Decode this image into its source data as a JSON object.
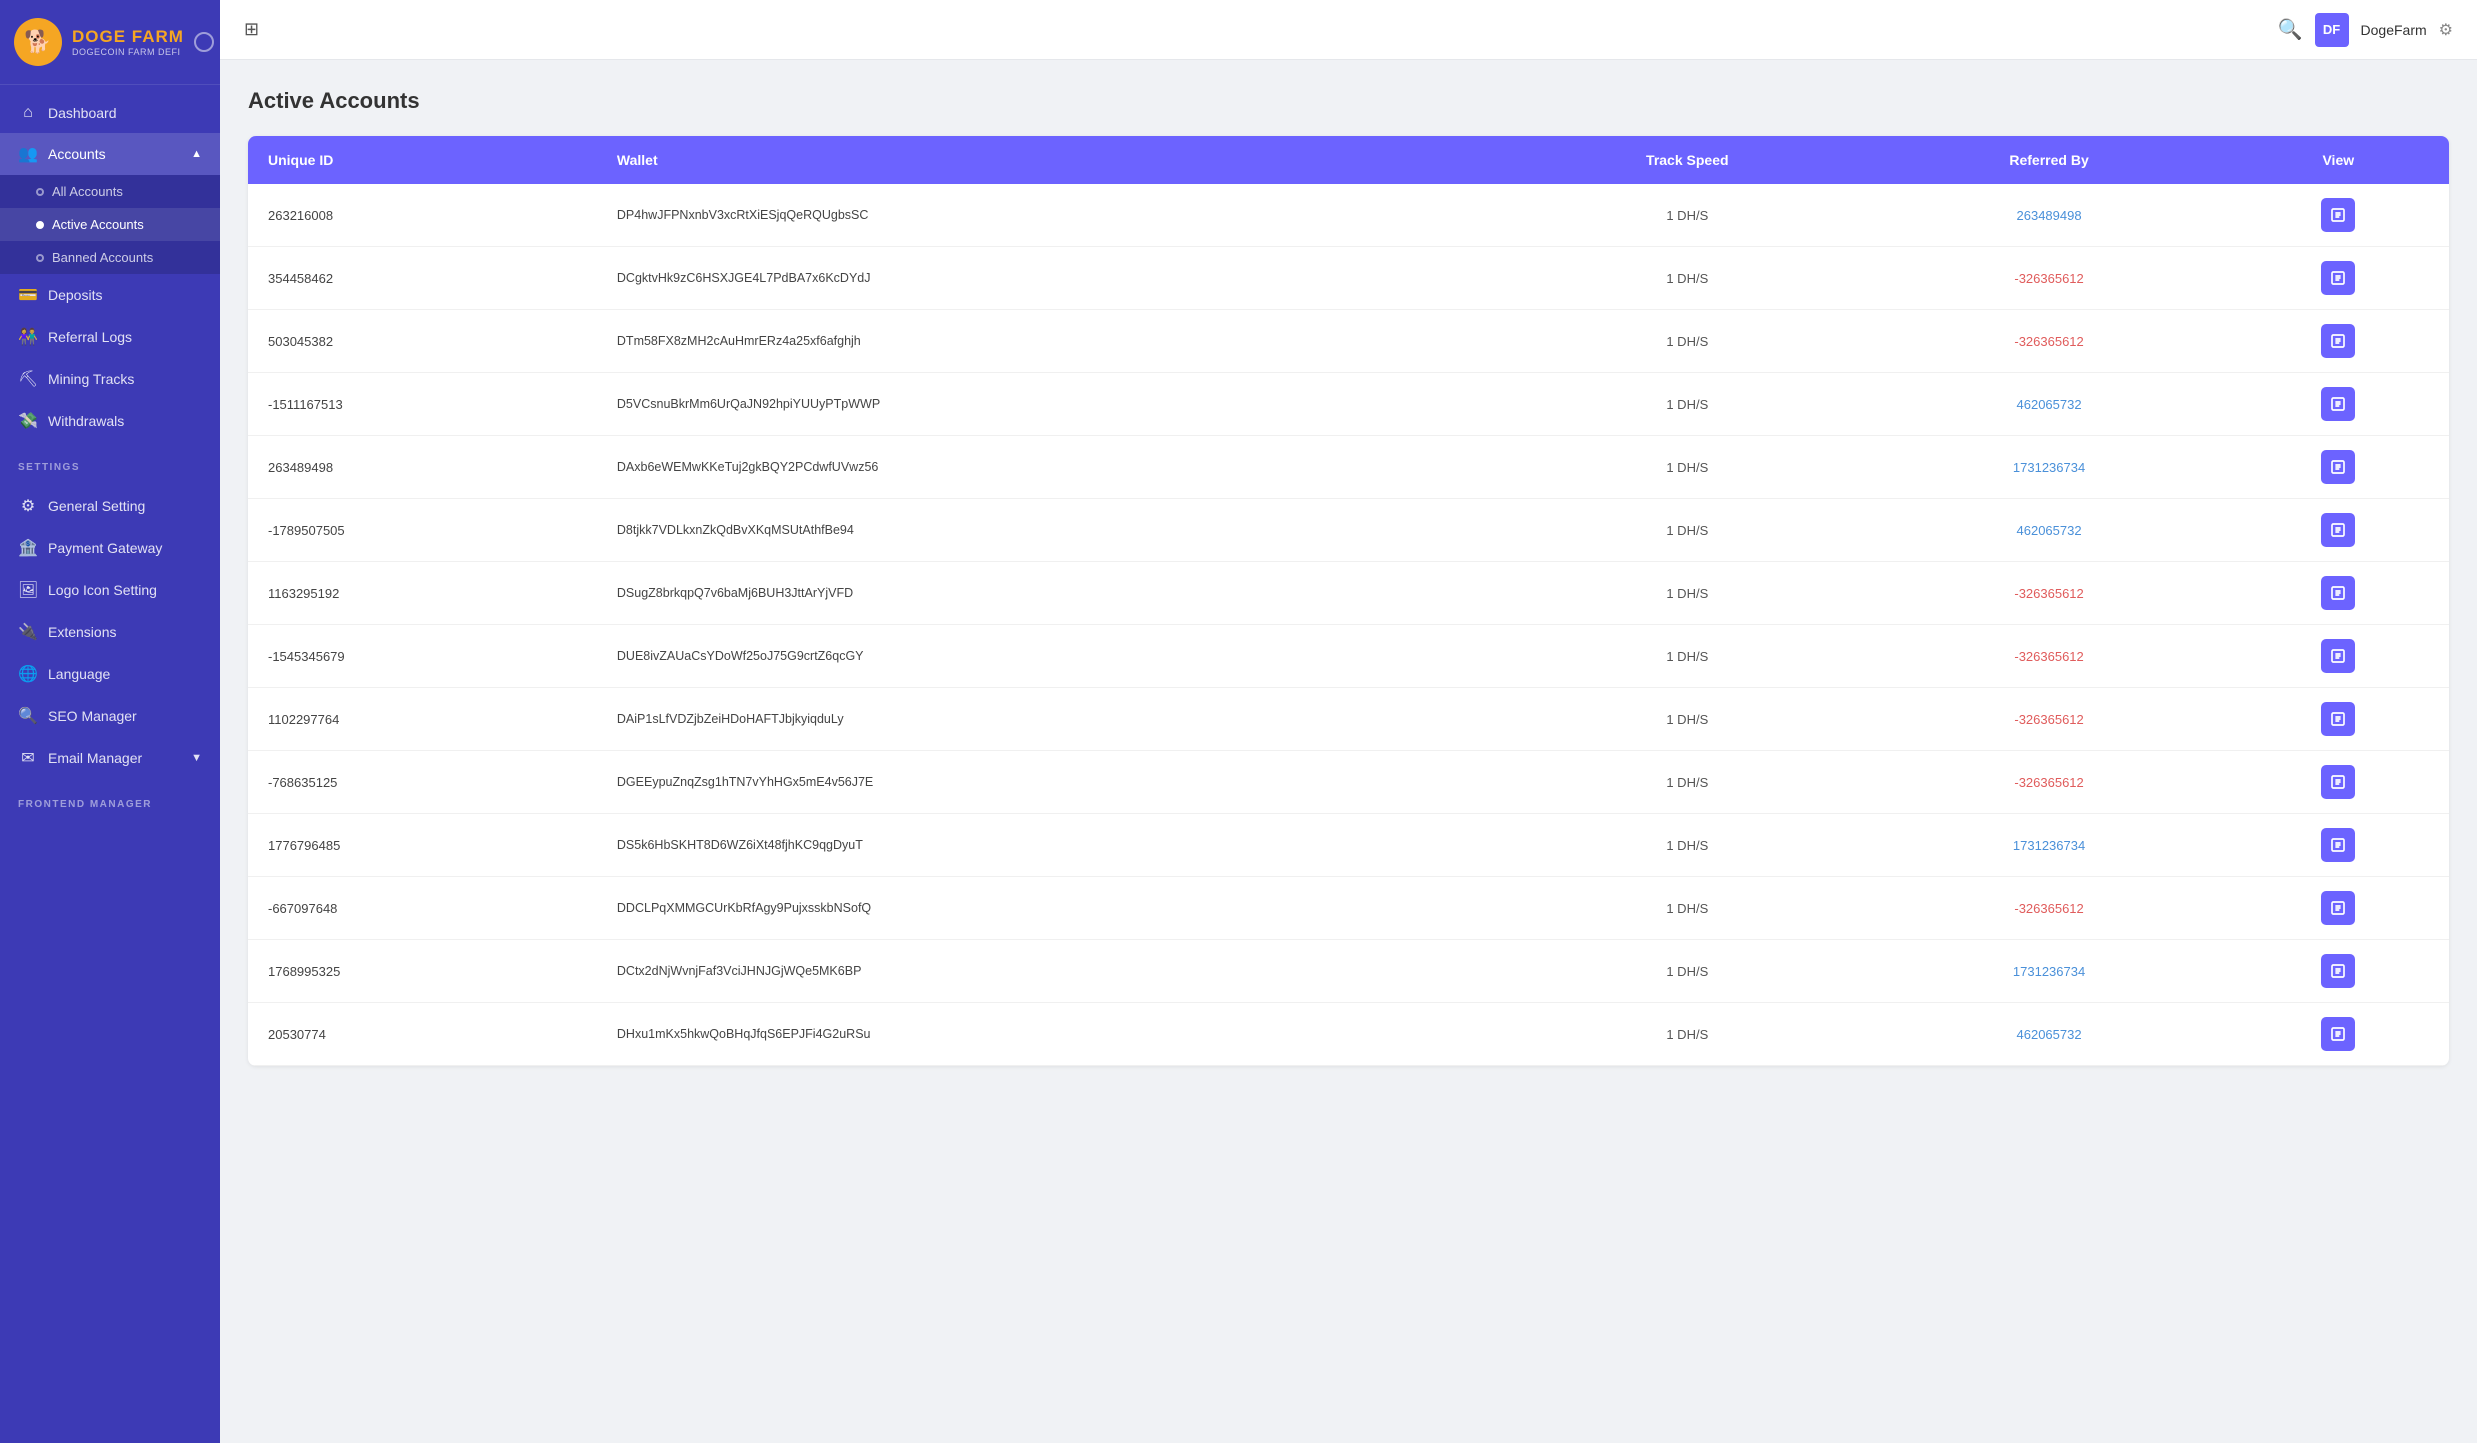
{
  "logo": {
    "title1": "DOGE",
    "title2": "FARM",
    "subtitle": "DOGECOIN FARM DEFI",
    "initial": "🐕"
  },
  "sidebar": {
    "nav_items": [
      {
        "id": "dashboard",
        "label": "Dashboard",
        "icon": "⌂",
        "active": false
      },
      {
        "id": "accounts",
        "label": "Accounts",
        "icon": "👥",
        "active": true,
        "expanded": true
      },
      {
        "id": "deposits",
        "label": "Deposits",
        "icon": "💳",
        "active": false
      },
      {
        "id": "referral-logs",
        "label": "Referral Logs",
        "icon": "👫",
        "active": false
      },
      {
        "id": "mining-tracks",
        "label": "Mining Tracks",
        "icon": "⛏",
        "active": false
      },
      {
        "id": "withdrawals",
        "label": "Withdrawals",
        "icon": "💸",
        "active": false
      }
    ],
    "sub_items": [
      {
        "id": "all-accounts",
        "label": "All Accounts",
        "active": false
      },
      {
        "id": "active-accounts",
        "label": "Active Accounts",
        "active": true
      },
      {
        "id": "banned-accounts",
        "label": "Banned Accounts",
        "active": false
      }
    ],
    "settings_items": [
      {
        "id": "general-setting",
        "label": "General Setting",
        "icon": "⚙"
      },
      {
        "id": "payment-gateway",
        "label": "Payment Gateway",
        "icon": "🏦"
      },
      {
        "id": "logo-icon-setting",
        "label": "Logo Icon Setting",
        "icon": "🖼"
      },
      {
        "id": "extensions",
        "label": "Extensions",
        "icon": "🔌"
      },
      {
        "id": "language",
        "label": "Language",
        "icon": "🌐"
      },
      {
        "id": "seo-manager",
        "label": "SEO Manager",
        "icon": "🔍"
      },
      {
        "id": "email-manager",
        "label": "Email Manager",
        "icon": "✉"
      }
    ],
    "settings_label": "SETTINGS",
    "frontend_label": "FRONTEND MANAGER"
  },
  "topbar": {
    "username": "DogeFarm",
    "avatar_text": "DF"
  },
  "page": {
    "title": "Active Accounts"
  },
  "table": {
    "columns": [
      "Unique ID",
      "Wallet",
      "Track Speed",
      "Referred By",
      "View"
    ],
    "rows": [
      {
        "uid": "263216008",
        "wallet": "DP4hwJFPNxnbV3xcRtXiESjqQeRQUgbsSC",
        "speed": "1 DH/S",
        "referred": "263489498",
        "ref_positive": true
      },
      {
        "uid": "354458462",
        "wallet": "DCgktvHk9zC6HSXJGE4L7PdBA7x6KcDYdJ",
        "speed": "1 DH/S",
        "referred": "-326365612",
        "ref_positive": false
      },
      {
        "uid": "503045382",
        "wallet": "DTm58FX8zMH2cAuHmrERz4a25xf6afghjh",
        "speed": "1 DH/S",
        "referred": "-326365612",
        "ref_positive": false
      },
      {
        "uid": "-1511167513",
        "wallet": "D5VCsnuBkrMm6UrQaJN92hpiYUUyPTpWWP",
        "speed": "1 DH/S",
        "referred": "462065732",
        "ref_positive": true
      },
      {
        "uid": "263489498",
        "wallet": "DAxb6eWEMwKKeTuj2gkBQY2PCdwfUVwz56",
        "speed": "1 DH/S",
        "referred": "1731236734",
        "ref_positive": true
      },
      {
        "uid": "-1789507505",
        "wallet": "D8tjkk7VDLkxnZkQdBvXKqMSUtAthfBe94",
        "speed": "1 DH/S",
        "referred": "462065732",
        "ref_positive": true
      },
      {
        "uid": "1163295192",
        "wallet": "DSugZ8brkqpQ7v6baMj6BUH3JttArYjVFD",
        "speed": "1 DH/S",
        "referred": "-326365612",
        "ref_positive": false
      },
      {
        "uid": "-1545345679",
        "wallet": "DUE8ivZAUaCsYDoWf25oJ75G9crtZ6qcGY",
        "speed": "1 DH/S",
        "referred": "-326365612",
        "ref_positive": false
      },
      {
        "uid": "1102297764",
        "wallet": "DAiP1sLfVDZjbZeiHDoHAFTJbjkyiqduLy",
        "speed": "1 DH/S",
        "referred": "-326365612",
        "ref_positive": false
      },
      {
        "uid": "-768635125",
        "wallet": "DGEEypuZnqZsg1hTN7vYhHGx5mE4v56J7E",
        "speed": "1 DH/S",
        "referred": "-326365612",
        "ref_positive": false
      },
      {
        "uid": "1776796485",
        "wallet": "DS5k6HbSKHT8D6WZ6iXt48fjhKC9qgDyuT",
        "speed": "1 DH/S",
        "referred": "1731236734",
        "ref_positive": true
      },
      {
        "uid": "-667097648",
        "wallet": "DDCLPqXMMGCUrKbRfAgy9PujxsskbNSofQ",
        "speed": "1 DH/S",
        "referred": "-326365612",
        "ref_positive": false
      },
      {
        "uid": "1768995325",
        "wallet": "DCtx2dNjWvnjFaf3VciJHNJGjWQe5MK6BP",
        "speed": "1 DH/S",
        "referred": "1731236734",
        "ref_positive": true
      },
      {
        "uid": "20530774",
        "wallet": "DHxu1mKx5hkwQoBHqJfqS6EPJFi4G2uRSu",
        "speed": "1 DH/S",
        "referred": "462065732",
        "ref_positive": true
      }
    ]
  }
}
